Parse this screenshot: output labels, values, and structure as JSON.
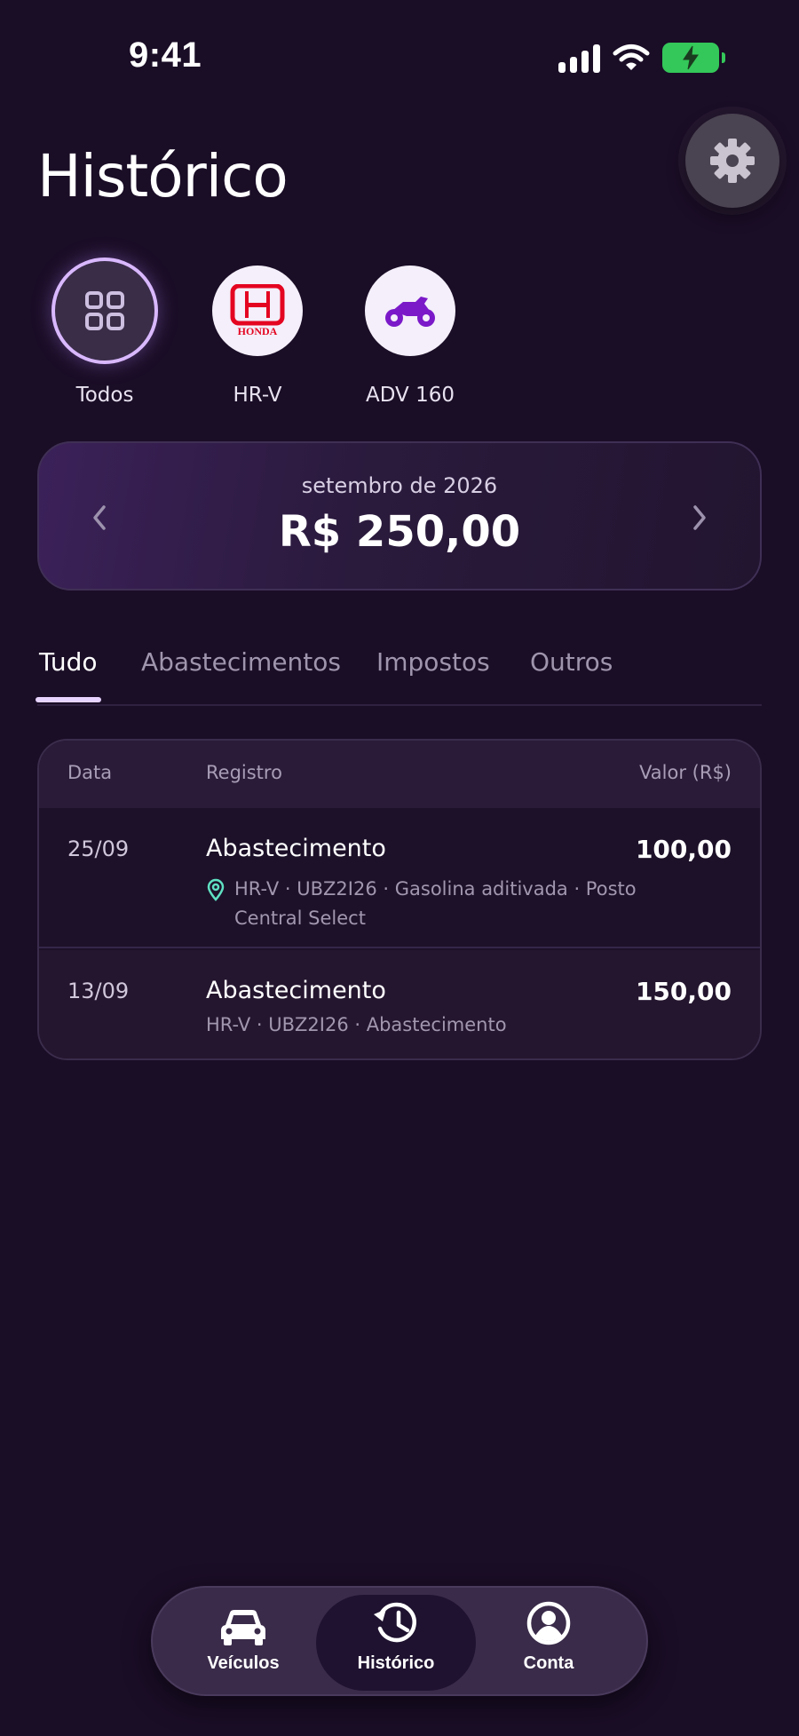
{
  "status_bar": {
    "time": "9:41"
  },
  "header": {
    "title": "Histórico"
  },
  "vehicles": [
    {
      "label": "Todos",
      "icon": "grid-icon",
      "active": true
    },
    {
      "label": "HR-V",
      "icon": "honda-logo-icon",
      "logo_text": "HONDA",
      "active": false
    },
    {
      "label": "ADV 160",
      "icon": "motorcycle-icon",
      "active": false
    }
  ],
  "month_card": {
    "month": "setembro de 2026",
    "total": "R$ 250,00"
  },
  "tabs": [
    {
      "label": "Tudo",
      "active": true
    },
    {
      "label": "Abastecimentos",
      "active": false
    },
    {
      "label": "Impostos",
      "active": false
    },
    {
      "label": "Outros",
      "active": false
    }
  ],
  "table": {
    "columns": {
      "date": "Data",
      "record": "Registro",
      "value": "Valor (R$)"
    },
    "rows": [
      {
        "date": "25/09",
        "title": "Abastecimento",
        "meta": "HR-V · UBZ2I26 · Gasolina aditivada · Posto Central Select",
        "value": "100,00",
        "has_location": true
      },
      {
        "date": "13/09",
        "title": "Abastecimento",
        "meta": "HR-V · UBZ2I26 · Abastecimento",
        "value": "150,00",
        "has_location": false
      }
    ]
  },
  "bottom_nav": [
    {
      "label": "Veículos",
      "icon": "car-icon",
      "active": false
    },
    {
      "label": "Histórico",
      "icon": "history-icon",
      "active": true
    },
    {
      "label": "Conta",
      "icon": "account-icon",
      "active": false
    }
  ],
  "colors": {
    "background": "#1a0d26",
    "accent": "#d9b8ff",
    "battery": "#34c759",
    "honda_red": "#e40521",
    "moto_purple": "#7b19c9",
    "location_pin": "#5fe0c2"
  }
}
